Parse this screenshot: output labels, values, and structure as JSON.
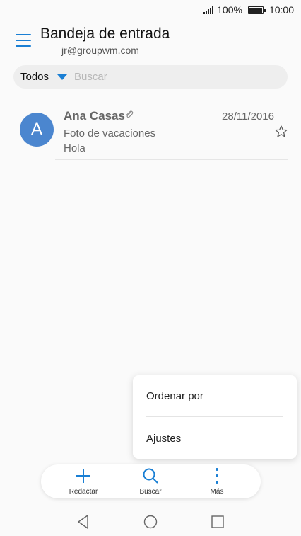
{
  "status_bar": {
    "battery": "100%",
    "time": "10:00"
  },
  "header": {
    "title": "Bandeja de entrada",
    "account": "jr@groupwm.com"
  },
  "filter": {
    "selected": "Todos",
    "search_placeholder": "Buscar"
  },
  "emails": [
    {
      "avatar_letter": "A",
      "sender": "Ana Casas",
      "date": "28/11/2016",
      "subject": "Foto de vacaciones",
      "preview": "Hola",
      "has_attachment": true,
      "starred": false
    }
  ],
  "popup_menu": {
    "items": [
      {
        "label": "Ordenar por"
      },
      {
        "label": "Ajustes"
      }
    ]
  },
  "action_bar": {
    "compose_label": "Redactar",
    "search_label": "Buscar",
    "more_label": "Más"
  },
  "colors": {
    "accent": "#1a7fd4",
    "avatar": "#4b86cf"
  }
}
